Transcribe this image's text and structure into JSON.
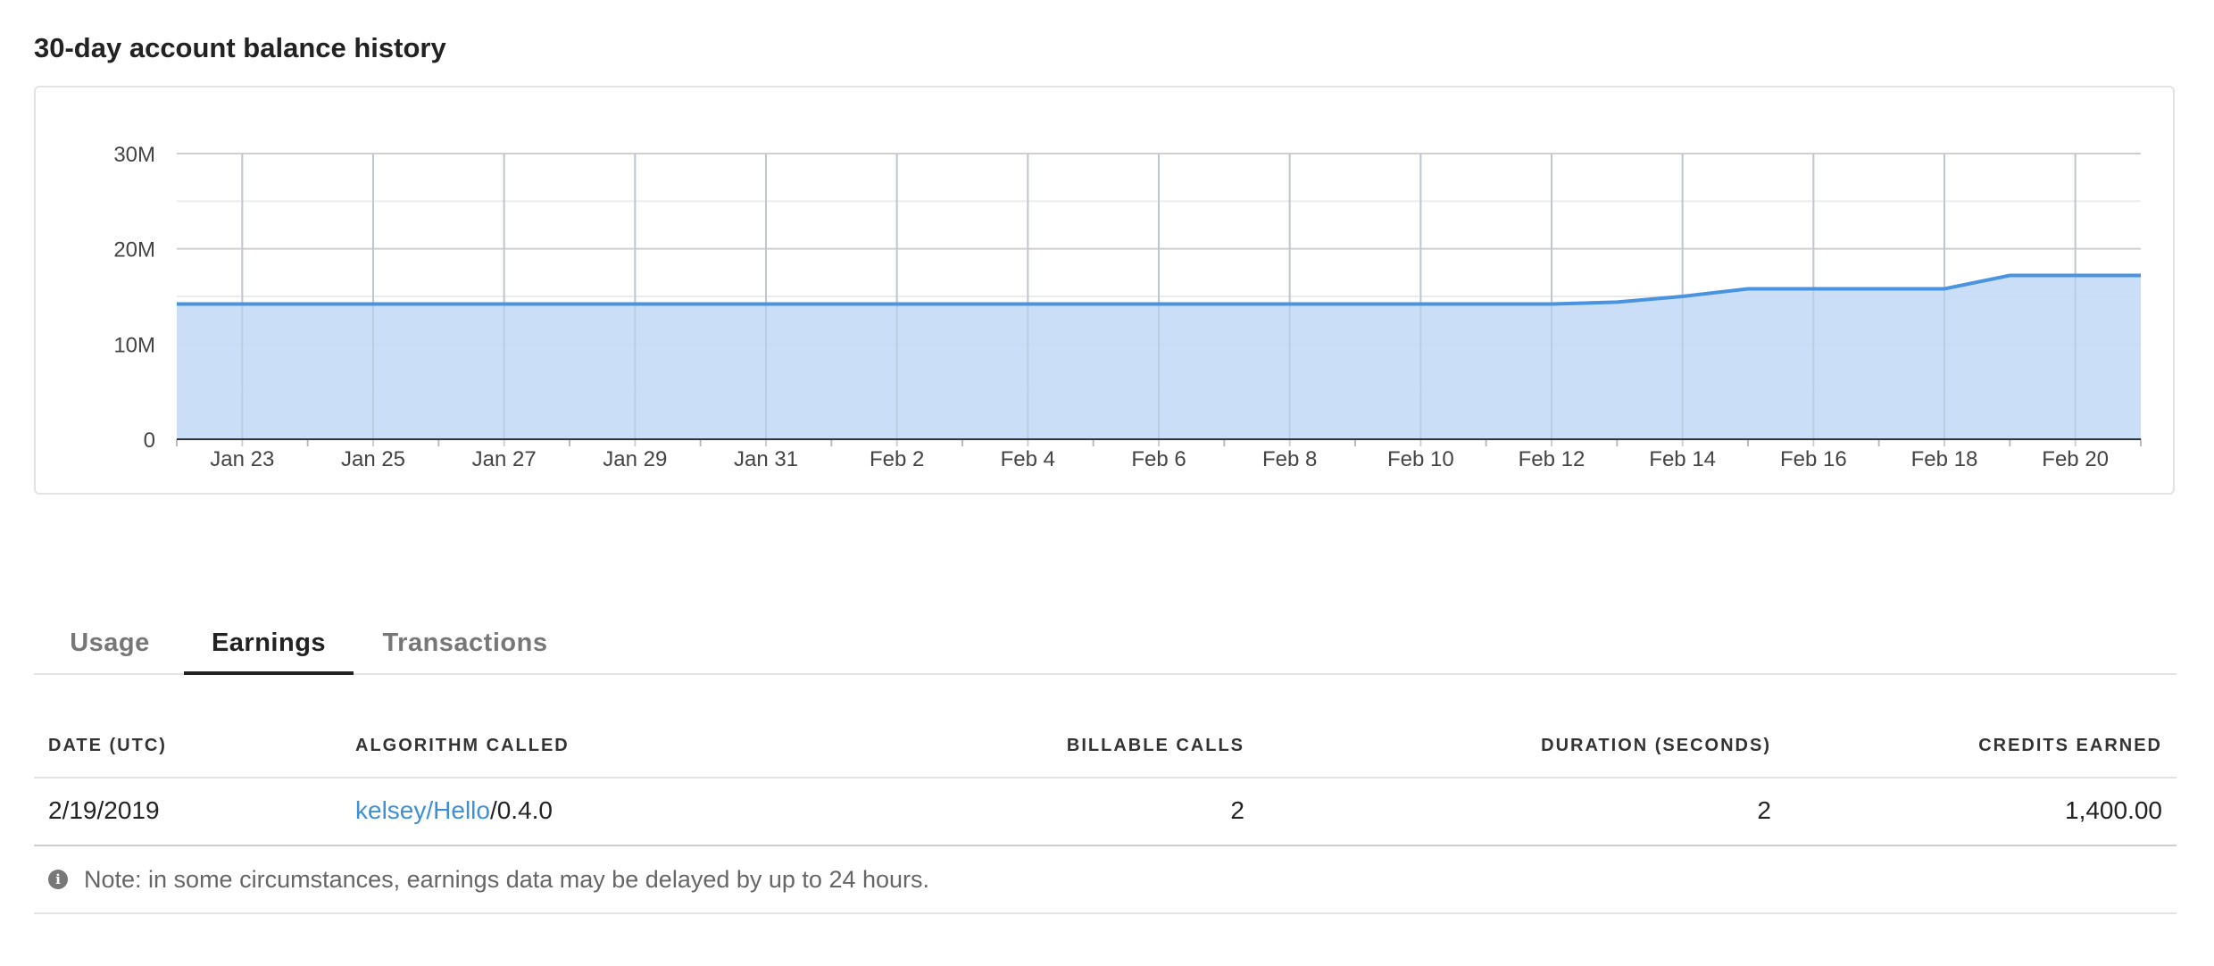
{
  "title": "30-day account balance history",
  "tabs": [
    {
      "label": "Usage"
    },
    {
      "label": "Earnings"
    },
    {
      "label": "Transactions"
    }
  ],
  "active_tab": "Earnings",
  "table": {
    "headers": [
      "DATE (UTC)",
      "ALGORITHM CALLED",
      "BILLABLE CALLS",
      "DURATION (SECONDS)",
      "CREDITS EARNED"
    ],
    "rows": [
      {
        "date": "2/19/2019",
        "algo_link": "kelsey/Hello",
        "algo_version": "/0.4.0",
        "billable_calls": "2",
        "duration": "2",
        "credits": "1,400.00"
      }
    ]
  },
  "note": "Note: in some circumstances, earnings data may be delayed by up to 24 hours.",
  "colors": {
    "line": "#4a93e0",
    "fill": "#c7ddf7",
    "accent_link": "#3d8fd9"
  },
  "icons": {
    "note_icon": "info-icon"
  },
  "chart_data": {
    "type": "area",
    "x_tick_labels": [
      "Jan 23",
      "Jan 25",
      "Jan 27",
      "Jan 29",
      "Jan 31",
      "Feb 2",
      "Feb 4",
      "Feb 6",
      "Feb 8",
      "Feb 10",
      "Feb 12",
      "Feb 14",
      "Feb 16",
      "Feb 18",
      "Feb 20"
    ],
    "y_tick_labels": [
      "0",
      "10M",
      "20M",
      "30M"
    ],
    "y_ticks": [
      0,
      10000000,
      20000000,
      30000000
    ],
    "ylim": [
      0,
      30000000
    ],
    "grid": true,
    "series": [
      {
        "x": [
          "Jan 22",
          "Jan 23",
          "Jan 24",
          "Jan 25",
          "Jan 26",
          "Jan 27",
          "Jan 28",
          "Jan 29",
          "Jan 30",
          "Jan 31",
          "Feb 1",
          "Feb 2",
          "Feb 3",
          "Feb 4",
          "Feb 5",
          "Feb 6",
          "Feb 7",
          "Feb 8",
          "Feb 9",
          "Feb 10",
          "Feb 11",
          "Feb 12",
          "Feb 13",
          "Feb 14",
          "Feb 15",
          "Feb 16",
          "Feb 17",
          "Feb 18",
          "Feb 19",
          "Feb 20",
          "Feb 21"
        ],
        "values": [
          14200000,
          14200000,
          14200000,
          14200000,
          14200000,
          14200000,
          14200000,
          14200000,
          14200000,
          14200000,
          14200000,
          14200000,
          14200000,
          14200000,
          14200000,
          14200000,
          14200000,
          14200000,
          14200000,
          14200000,
          14200000,
          14200000,
          14400000,
          15000000,
          15800000,
          15800000,
          15800000,
          15800000,
          17200000,
          17200000,
          17200000
        ]
      }
    ]
  }
}
